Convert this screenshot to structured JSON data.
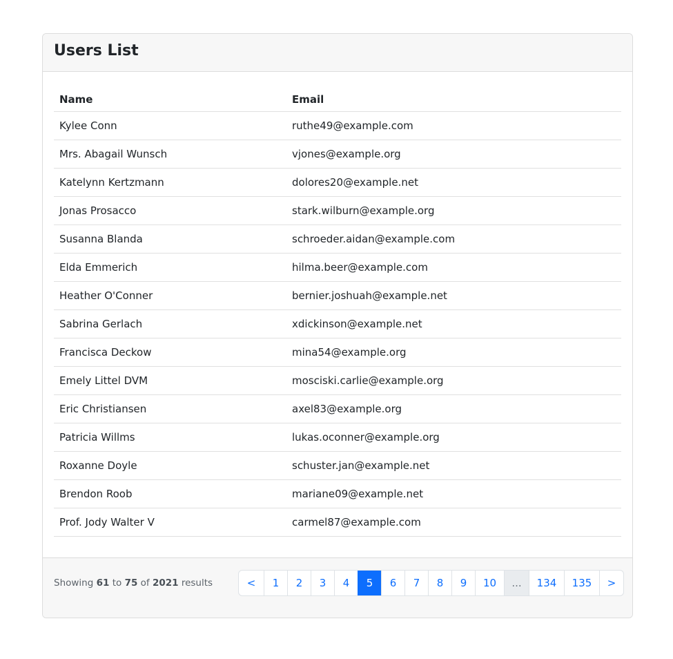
{
  "card": {
    "title": "Users List"
  },
  "table": {
    "headers": {
      "name": "Name",
      "email": "Email"
    },
    "rows": [
      {
        "name": "Kylee Conn",
        "email": "ruthe49@example.com"
      },
      {
        "name": "Mrs. Abagail Wunsch",
        "email": "vjones@example.org"
      },
      {
        "name": "Katelynn Kertzmann",
        "email": "dolores20@example.net"
      },
      {
        "name": "Jonas Prosacco",
        "email": "stark.wilburn@example.org"
      },
      {
        "name": "Susanna Blanda",
        "email": "schroeder.aidan@example.com"
      },
      {
        "name": "Elda Emmerich",
        "email": "hilma.beer@example.com"
      },
      {
        "name": "Heather O'Conner",
        "email": "bernier.joshuah@example.net"
      },
      {
        "name": "Sabrina Gerlach",
        "email": "xdickinson@example.net"
      },
      {
        "name": "Francisca Deckow",
        "email": "mina54@example.org"
      },
      {
        "name": "Emely Littel DVM",
        "email": "mosciski.carlie@example.org"
      },
      {
        "name": "Eric Christiansen",
        "email": "axel83@example.org"
      },
      {
        "name": "Patricia Willms",
        "email": "lukas.oconner@example.org"
      },
      {
        "name": "Roxanne Doyle",
        "email": "schuster.jan@example.net"
      },
      {
        "name": "Brendon Roob",
        "email": "mariane09@example.net"
      },
      {
        "name": "Prof. Jody Walter V",
        "email": "carmel87@example.com"
      }
    ]
  },
  "footer": {
    "summary": {
      "showing": "Showing",
      "from": "61",
      "to_word": "to",
      "to": "75",
      "of_word": "of",
      "total": "2021",
      "results_word": "results"
    },
    "pagination": {
      "prev": "<",
      "pages": [
        "1",
        "2",
        "3",
        "4",
        "5",
        "6",
        "7",
        "8",
        "9",
        "10"
      ],
      "current": "5",
      "ellipsis": "...",
      "last_pages": [
        "134",
        "135"
      ],
      "next": ">"
    }
  },
  "colors": {
    "accent": "#0d6efd",
    "header_bg": "#f7f7f7",
    "border": "#dcdcdc"
  }
}
